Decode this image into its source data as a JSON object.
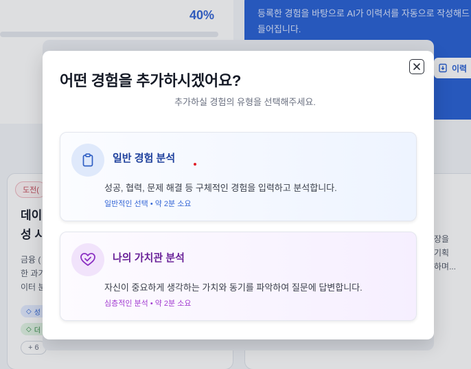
{
  "background": {
    "progress_percent": "40%",
    "info_text": "등록한 경험을 바탕으로 AI가 이력서를 자동으로 작성해드\n들어집니다.",
    "resume_button_label": "이력",
    "card_tag": "도전(",
    "card_title_line1": "데이",
    "card_title_line2": "성 시",
    "card_desc_line1": "금융 (",
    "card_desc_line2": "한 과기",
    "card_desc_line3": "이터 분",
    "chip_a": "성",
    "chip_b": "더",
    "chip_more": "+ 6",
    "right_text_line1": "장을",
    "right_text_line2": "기획",
    "right_text_line3": "하며..."
  },
  "modal": {
    "title": "어떤 경험을 추가하시겠어요?",
    "subtitle": "추가하실 경험의 유형을 선택해주세요.",
    "close_icon": "close-icon",
    "options": [
      {
        "title": "일반 경험 분석",
        "description": "성공, 협력, 문제 해결 등 구체적인 경험을 입력하고 분석합니다.",
        "meta": "일반적인 선택 • 약 2분 소요",
        "icon": "clipboard-icon"
      },
      {
        "title": "나의 가치관 분석",
        "description": "자신이 중요하게 생각하는 가치와 동기를 파악하여 질문에 답변합니다.",
        "meta": "심층적인 분석 • 약 2분 소요",
        "icon": "heart-handshake-icon"
      }
    ]
  },
  "colors": {
    "primary": "#2c63d6",
    "general_title": "#1d3f9c",
    "values_title": "#6a2399",
    "values_meta": "#a23bd0"
  }
}
